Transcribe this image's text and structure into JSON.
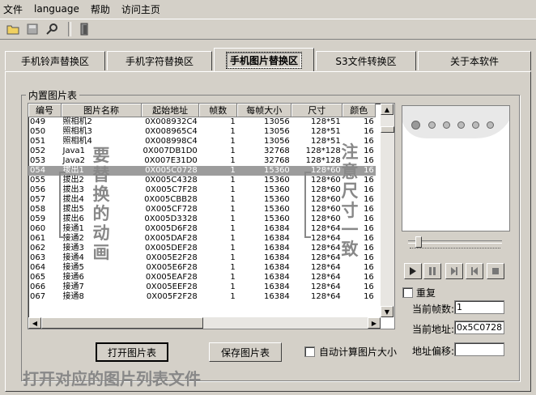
{
  "menu": [
    "文件",
    "language",
    "帮助",
    "访问主页"
  ],
  "toolbar": {
    "icons": [
      "open-icon",
      "save-icon",
      "search-icon",
      "exit-icon"
    ]
  },
  "tabs": [
    {
      "label": "手机铃声替换区",
      "active": false
    },
    {
      "label": "手机字符替换区",
      "active": false
    },
    {
      "label": "手机图片替换区",
      "active": true
    },
    {
      "label": "S3文件转换区",
      "active": false
    },
    {
      "label": "关于本软件",
      "active": false
    }
  ],
  "group": {
    "title": "内置图片表"
  },
  "table": {
    "headers": [
      "编号",
      "图片名称",
      "起始地址",
      "帧数",
      "每帧大小",
      "尺寸",
      "颜色"
    ],
    "selected_index": 5,
    "rows": [
      [
        "049",
        "照相机2",
        "0X008932C4",
        "1",
        "13056",
        "128*51",
        "16"
      ],
      [
        "050",
        "照相机3",
        "0X008965C4",
        "1",
        "13056",
        "128*51",
        "16"
      ],
      [
        "051",
        "照相机4",
        "0X008998C4",
        "1",
        "13056",
        "128*51",
        "16"
      ],
      [
        "052",
        "Java1",
        "0X007DB1D0",
        "1",
        "32768",
        "128*128",
        "16"
      ],
      [
        "053",
        "Java2",
        "0X007E31D0",
        "1",
        "32768",
        "128*128",
        "16"
      ],
      [
        "054",
        "拔出1",
        "0X005C0728",
        "1",
        "15360",
        "128*60",
        "16"
      ],
      [
        "055",
        "拔出2",
        "0X005C4328",
        "1",
        "15360",
        "128*60",
        "16"
      ],
      [
        "056",
        "拔出3",
        "0X005C7F28",
        "1",
        "15360",
        "128*60",
        "16"
      ],
      [
        "057",
        "拔出4",
        "0X005CBB28",
        "1",
        "15360",
        "128*60",
        "16"
      ],
      [
        "058",
        "拔出5",
        "0X005CF728",
        "1",
        "15360",
        "128*60",
        "16"
      ],
      [
        "059",
        "拔出6",
        "0X005D3328",
        "1",
        "15360",
        "128*60",
        "16"
      ],
      [
        "060",
        "接通1",
        "0X005D6F28",
        "1",
        "16384",
        "128*64",
        "16"
      ],
      [
        "061",
        "接通2",
        "0X005DAF28",
        "1",
        "16384",
        "128*64",
        "16"
      ],
      [
        "062",
        "接通3",
        "0X005DEF28",
        "1",
        "16384",
        "128*64",
        "16"
      ],
      [
        "063",
        "接通4",
        "0X005E2F28",
        "1",
        "16384",
        "128*64",
        "16"
      ],
      [
        "064",
        "接通5",
        "0X005E6F28",
        "1",
        "16384",
        "128*64",
        "16"
      ],
      [
        "065",
        "接通6",
        "0X005EAF28",
        "1",
        "16384",
        "128*64",
        "16"
      ],
      [
        "066",
        "接通7",
        "0X005EEF28",
        "1",
        "16384",
        "128*64",
        "16"
      ],
      [
        "067",
        "接通8",
        "0X005F2F28",
        "1",
        "16384",
        "128*64",
        "16"
      ]
    ]
  },
  "buttons": {
    "open": "打开图片表",
    "save": "保存图片表"
  },
  "auto_calc": {
    "label": "自动计算图片大小",
    "checked": false
  },
  "repeat": {
    "label": "重复",
    "checked": false
  },
  "fields": {
    "current_frame": {
      "label": "当前帧数:",
      "value": "1"
    },
    "current_address": {
      "label": "当前地址:",
      "value": "0x5C0728"
    },
    "address_offset": {
      "label": "地址偏移:",
      "value": ""
    }
  },
  "annotations": {
    "replace_anim": [
      "要",
      "替",
      "换",
      "的",
      "动",
      "画"
    ],
    "size_note": [
      "注",
      "意",
      "尺",
      "寸",
      "一",
      "致"
    ],
    "bottom": "打开对应的图片列表文件"
  }
}
